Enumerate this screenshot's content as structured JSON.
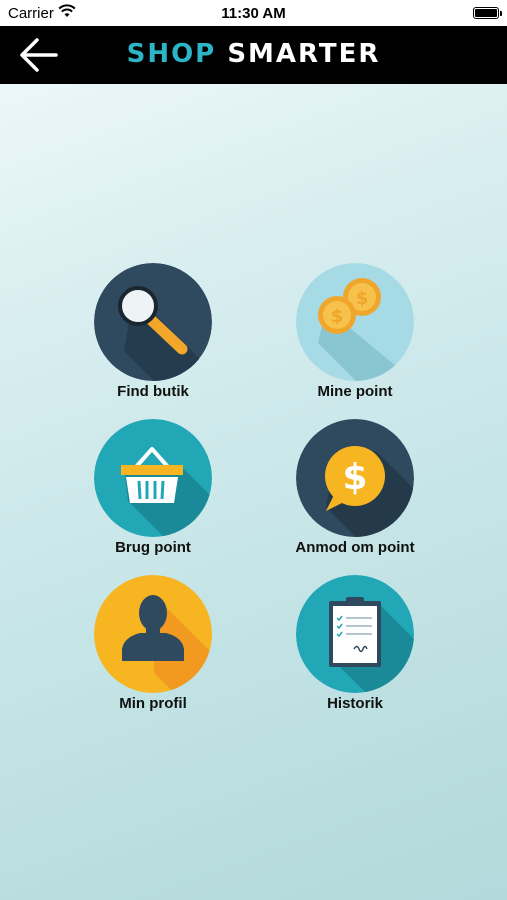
{
  "status_bar": {
    "carrier": "Carrier",
    "time": "11:30 AM",
    "signal_icon": "wifi-icon",
    "battery_icon": "battery-icon"
  },
  "nav": {
    "back_icon": "back-arrow-icon",
    "title_part1": "SHOP",
    "title_part2": "SMARTER"
  },
  "menu": [
    {
      "label": "Find butik",
      "icon": "magnifier-icon",
      "color": "#2f4a5f"
    },
    {
      "label": "Mine point",
      "icon": "coins-icon",
      "color": "#a6dbe6"
    },
    {
      "label": "Brug point",
      "icon": "basket-icon",
      "color": "#22a7b7"
    },
    {
      "label": "Anmod om point",
      "icon": "dollar-bubble-icon",
      "color": "#2f4a5f"
    },
    {
      "label": "Min profil",
      "icon": "user-silhouette-icon",
      "color": "#f7b522"
    },
    {
      "label": "Historik",
      "icon": "clipboard-icon",
      "color": "#22a7b7"
    }
  ],
  "colors": {
    "nav_background": "#000000",
    "brand_accent": "#2bb5c6"
  }
}
